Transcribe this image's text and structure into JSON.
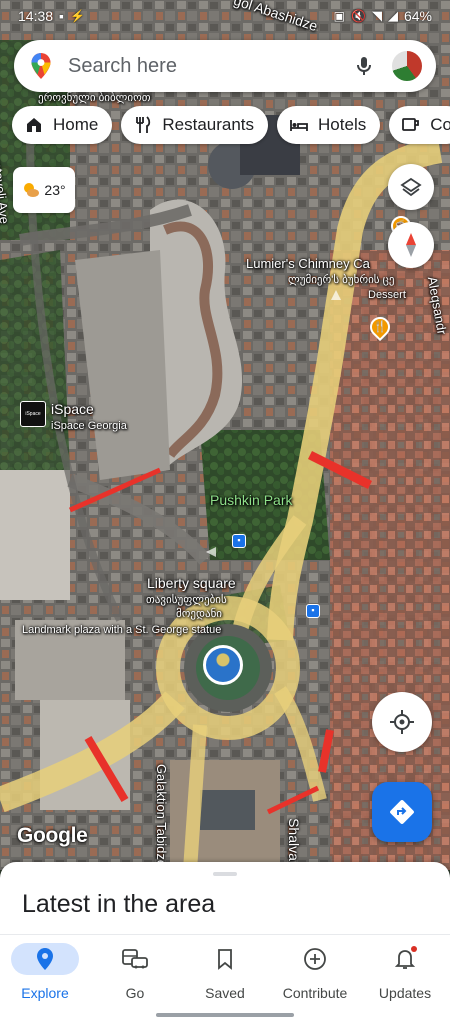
{
  "status_bar": {
    "time": "14:38",
    "battery": "64%"
  },
  "search": {
    "placeholder": "Search here"
  },
  "chips": [
    {
      "label": "Home",
      "icon": "home-icon"
    },
    {
      "label": "Restaurants",
      "icon": "fork-knife-icon"
    },
    {
      "label": "Hotels",
      "icon": "bed-icon"
    },
    {
      "label": "Co",
      "icon": "coffee-icon"
    }
  ],
  "weather": {
    "temperature": "23°",
    "icon": "partly-sunny-icon"
  },
  "map": {
    "labels": {
      "street_top": "gol Abashidze",
      "georgian_top_left": "ეროვნული ბიბლიოთ",
      "street_left": "ustaveli Ave",
      "chimney_name": "Lumier's Chimney Ca",
      "chimney_georgian": "ლუმიერ'ს ბუხრის ცე",
      "chimney_category": "Dessert",
      "street_right": "Aleqsandr",
      "ispace_name": "iSpace",
      "ispace_sub": "iSpace Georgia",
      "ispace_logo": "iSpace",
      "park": "Pushkin Park",
      "square": "Liberty square",
      "square_georgian_1": "თავისუფლების",
      "square_georgian_2": "მოედანი",
      "landmark": "Landmark plaza with a St. George statue",
      "street_bottom": "Galaktion Tabidze",
      "street_bottom_right": "Shalva"
    },
    "colors": {
      "road": "#e8cf7a",
      "traffic_red": "#e8322a"
    }
  },
  "watermark": "Google",
  "sheet": {
    "title": "Latest in the area"
  },
  "nav": [
    {
      "label": "Explore",
      "active": true
    },
    {
      "label": "Go"
    },
    {
      "label": "Saved"
    },
    {
      "label": "Contribute"
    },
    {
      "label": "Updates"
    }
  ]
}
